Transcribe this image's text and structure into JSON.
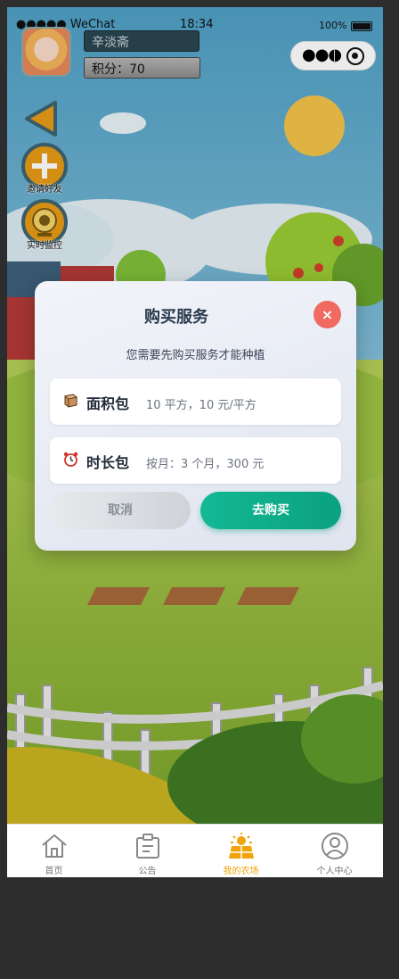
{
  "status_bar": {
    "carrier": "●●●●● WeChat",
    "time": "18:34",
    "battery": "100%"
  },
  "user": {
    "name": "辛淡斋",
    "score": "积分：70"
  },
  "side_buttons": [
    {
      "label": "邀请好友",
      "icon": "plus-icon"
    },
    {
      "label": "实时监控",
      "icon": "camera-icon"
    }
  ],
  "dialog": {
    "title": "购买服务",
    "close": "×",
    "subtitle": "您需要先购买服务才能种植",
    "packages": [
      {
        "name": "面积包",
        "desc": "10 平方，10 元/平方",
        "icon": "box-icon"
      },
      {
        "name": "时长包",
        "desc": "按月：3 个月，300 元",
        "icon": "alarm-clock-icon"
      }
    ],
    "cancel_label": "取消",
    "buy_label": "去购买"
  },
  "tabbar": {
    "items": [
      {
        "label": "首页",
        "icon": "home-icon"
      },
      {
        "label": "公告",
        "icon": "notice-icon"
      },
      {
        "label": "我的农场",
        "icon": "farm-icon",
        "active": true
      },
      {
        "label": "个人中心",
        "icon": "user-icon"
      }
    ]
  },
  "colors": {
    "accent": "#0aa17f",
    "active_tab": "#f0a30a",
    "close": "#f06a62"
  }
}
